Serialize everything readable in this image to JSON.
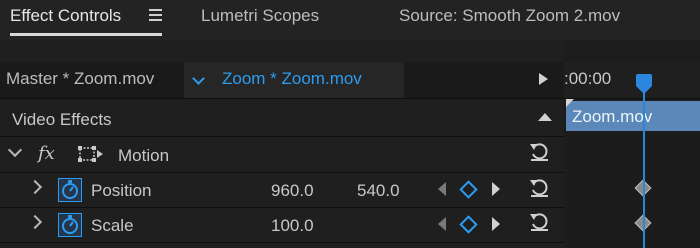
{
  "tabs": [
    {
      "label": "Effect Controls"
    },
    {
      "label": "Lumetri Scopes"
    },
    {
      "label": "Source: Smooth Zoom 2.mov"
    }
  ],
  "subtabs": {
    "master": "Master * Zoom.mov",
    "clip": "Zoom * Zoom.mov"
  },
  "timecode": ":00:00",
  "clip_label": "Zoom.mov",
  "section_title": "Video Effects",
  "motion": {
    "fx": "fx",
    "label": "Motion"
  },
  "properties": [
    {
      "label": "Position",
      "value1": "960.0",
      "value2": "540.0"
    },
    {
      "label": "Scale",
      "value1": "100.0"
    }
  ],
  "colors": {
    "accent": "#2b9cf0",
    "clip": "#5b88b8",
    "background": "#1d1d1d"
  }
}
